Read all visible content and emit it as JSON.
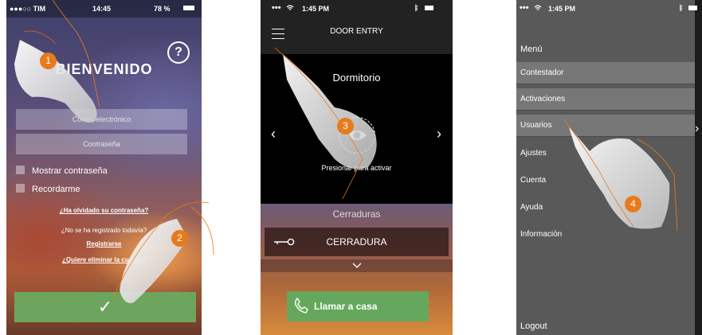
{
  "screen1": {
    "status": {
      "carrier": "●●●○○ TIM",
      "time": "14:45",
      "battery": "78 %"
    },
    "help_label": "?",
    "title": "BIENVENIDO",
    "email_placeholder": "Correo electrónico",
    "password_placeholder": "Contraseña",
    "show_password": "Mostrar contraseña",
    "remember_me": "Recordarme",
    "forgot_link": "¿Ha olvidado su contraseña?",
    "not_registered": "¿No se ha registrado todavía?",
    "register_link": "Registrarse",
    "delete_account_link": "¿Quiere eliminar la cuenta?",
    "confirm_symbol": "✓"
  },
  "screen2": {
    "status": {
      "dots": "•••",
      "time": "1:45 PM"
    },
    "header_title": "DOOR ENTRY",
    "room": "Dormitorio",
    "prev_arrow": "‹",
    "next_arrow": "›",
    "activate_hint": "Presionar para activar",
    "locks_title": "Cerraduras",
    "lock_name": "CERRADURA",
    "expand_symbol": "⌄",
    "call_home": "Llamar a casa"
  },
  "screen3": {
    "status": {
      "dots": "•••",
      "time": "1:45 PM"
    },
    "menu_title": "Menú",
    "items": [
      "Contestador",
      "Activaciones",
      "Usuarios",
      "Ajustes",
      "Cuenta",
      "Ayuda",
      "Información"
    ],
    "logout": "Logout",
    "peek_arrow": "›"
  },
  "steps": [
    "1",
    "2",
    "3",
    "4"
  ],
  "colors": {
    "accent_orange": "#e77b1c",
    "confirm_green": "#6ea55e",
    "menu_grey": "#595959",
    "menu_highlight": "#777777"
  }
}
